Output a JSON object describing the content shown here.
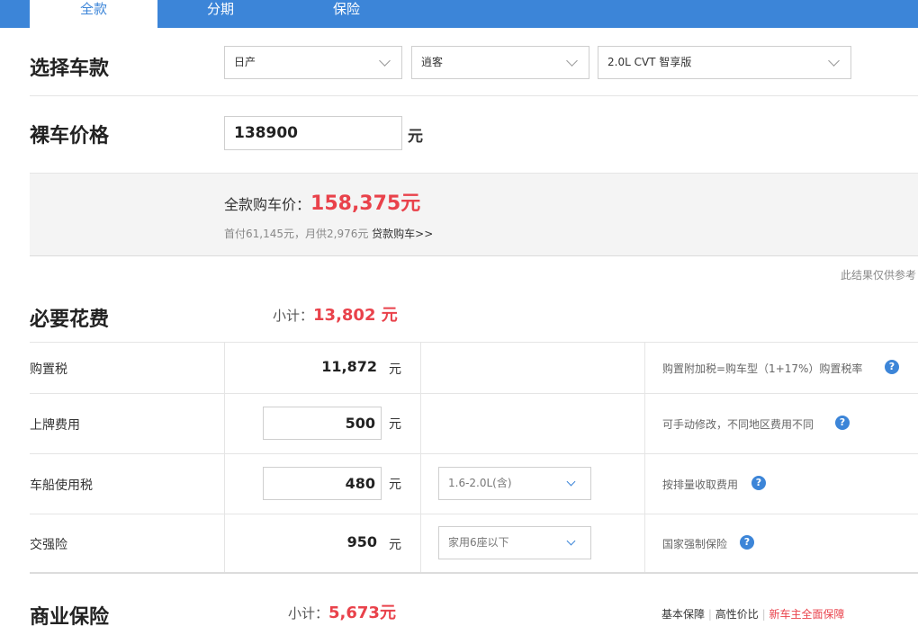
{
  "tabs": [
    {
      "label": "全款",
      "active": true
    },
    {
      "label": "分期",
      "active": false
    },
    {
      "label": "保险",
      "active": false
    }
  ],
  "select_car": {
    "title": "选择车款",
    "brand": "日产",
    "series": "逍客",
    "model": "2.0L CVT 智享版"
  },
  "bare_price": {
    "title": "裸车价格",
    "value": "138900",
    "unit": "元"
  },
  "summary": {
    "label": "全款购车价：",
    "total": "158,375元",
    "detail": "首付61,145元，月供2,976元",
    "loan_link": "贷款购车>>",
    "disclaimer": "此结果仅供参考"
  },
  "required": {
    "title": "必要花费",
    "subtotal_label": "小计：",
    "subtotal_value": "13,802 元",
    "unit": "元",
    "rows": [
      {
        "label": "购置税",
        "value": "11,872",
        "note": "购置附加税=购车型（1+17%）购置税率"
      },
      {
        "label": "上牌费用",
        "value": "500",
        "note": "可手动修改，不同地区费用不同"
      },
      {
        "label": "车船使用税",
        "value": "480",
        "option": "1.6-2.0L(含)",
        "note": "按排量收取费用"
      },
      {
        "label": "交强险",
        "value": "950",
        "option": "家用6座以下",
        "note": "国家强制保险"
      }
    ]
  },
  "commercial": {
    "title": "商业保险",
    "subtotal_label": "小计：",
    "subtotal_value": "5,673元",
    "links": [
      "基本保障",
      "高性价比",
      "新车主全面保障"
    ]
  },
  "icons": {
    "help": "question-circle-icon",
    "chevron": "chevron-down-icon"
  },
  "colors": {
    "accent": "#3c85d8",
    "price_red": "#e9424b"
  }
}
